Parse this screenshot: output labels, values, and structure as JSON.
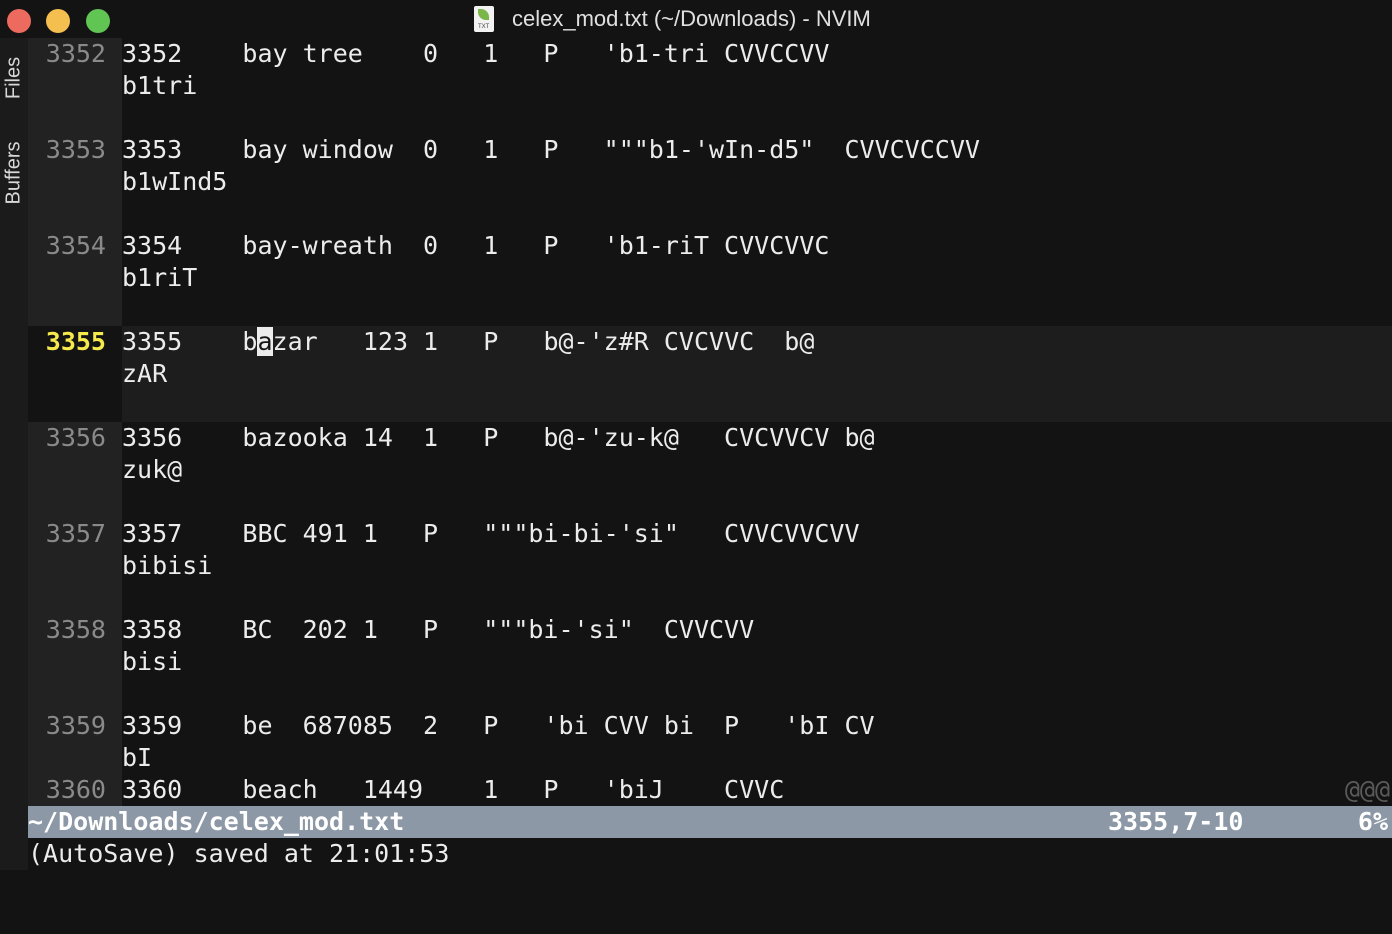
{
  "window": {
    "title": "celex_mod.txt (~/Downloads) - NVIM",
    "file_icon_tag": "TXT",
    "controls": [
      "close",
      "minimize",
      "zoom"
    ]
  },
  "side_tabs": [
    "Files",
    "Buffers"
  ],
  "editor": {
    "lines": [
      {
        "num": "3352",
        "text": "3352    bay tree    0   1   P   'b1-tri CVVCCVV",
        "wrap": "b1tri"
      },
      {
        "num": "3353",
        "text": "3353    bay window  0   1   P   \"\"\"b1-'wIn-d5\"  CVVCVCCVV",
        "wrap": "b1wInd5"
      },
      {
        "num": "3354",
        "text": "3354    bay-wreath  0   1   P   'b1-riT CVVCVVC",
        "wrap": "b1riT"
      },
      {
        "num": "3355",
        "text_before_cursor": "3355    b",
        "cursor_char": "a",
        "text_after_cursor": "zar   123 1   P   b@-'z#R CVCVVC  b@",
        "wrap": "zAR"
      },
      {
        "num": "3356",
        "text": "3356    bazooka 14  1   P   b@-'zu-k@   CVCVVCV b@",
        "wrap": "zuk@"
      },
      {
        "num": "3357",
        "text": "3357    BBC 491 1   P   \"\"\"bi-bi-'si\"   CVVCVVCVV",
        "wrap": "bibisi"
      },
      {
        "num": "3358",
        "text": "3358    BC  202 1   P   \"\"\"bi-'si\"  CVVCVV",
        "wrap": "bisi"
      },
      {
        "num": "3359",
        "text": "3359    be  687085  2   P   'bi CVV bi  P   'bI CV",
        "wrap": "bI"
      },
      {
        "num": "3360",
        "text": "3360    beach   1449    1   P   'biJ    CVVC",
        "wrap": ""
      }
    ],
    "overflow_marker": "@@@"
  },
  "statusline": {
    "path": "~/Downloads/celex_mod.txt",
    "position": "3355,7-10",
    "percent": "6%"
  },
  "cmdline": "(AutoSave) saved at 21:01:53",
  "colors": {
    "background": "#131313",
    "gutter": "#222222",
    "current_line_number": "#f5e94b",
    "statusline": "#8c98a6"
  }
}
